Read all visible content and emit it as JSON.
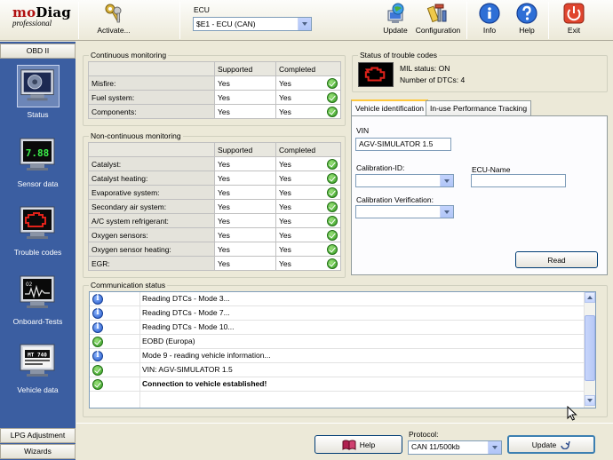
{
  "app": {
    "logo_main_a": "mo",
    "logo_main_b": "Diag",
    "logo_sub": "professional"
  },
  "toolbar": {
    "activate_label": "Activate...",
    "ecu_label": "ECU",
    "ecu_value": "$E1 - ECU (CAN)",
    "update_label": "Update",
    "configuration_label": "Configuration",
    "info_label": "Info",
    "help_label": "Help",
    "exit_label": "Exit"
  },
  "sidebar": {
    "header": "OBD II",
    "items": [
      {
        "label": "Status",
        "icon": "engine-monitor-icon",
        "active": true
      },
      {
        "label": "Sensor data",
        "icon": "sensor-display-icon",
        "screen_text": "7.88"
      },
      {
        "label": "Trouble codes",
        "icon": "engine-warning-monitor-icon"
      },
      {
        "label": "Onboard-Tests",
        "icon": "oscilloscope-monitor-icon",
        "screen_text": "O2"
      },
      {
        "label": "Vehicle data",
        "icon": "vehicle-data-monitor-icon",
        "screen_text": "MT 740"
      }
    ],
    "footer_items": [
      "LPG Adjustment",
      "Wizards"
    ]
  },
  "continuous": {
    "title": "Continuous monitoring",
    "col_supported": "Supported",
    "col_completed": "Completed",
    "rows": [
      {
        "name": "Misfire:",
        "supported": "Yes",
        "completed": "Yes"
      },
      {
        "name": "Fuel system:",
        "supported": "Yes",
        "completed": "Yes"
      },
      {
        "name": "Components:",
        "supported": "Yes",
        "completed": "Yes"
      }
    ]
  },
  "noncontinuous": {
    "title": "Non-continuous monitoring",
    "col_supported": "Supported",
    "col_completed": "Completed",
    "rows": [
      {
        "name": "Catalyst:",
        "supported": "Yes",
        "completed": "Yes"
      },
      {
        "name": "Catalyst heating:",
        "supported": "Yes",
        "completed": "Yes"
      },
      {
        "name": "Evaporative system:",
        "supported": "Yes",
        "completed": "Yes"
      },
      {
        "name": "Secondary air system:",
        "supported": "Yes",
        "completed": "Yes"
      },
      {
        "name": "A/C system refrigerant:",
        "supported": "Yes",
        "completed": "Yes"
      },
      {
        "name": "Oxygen sensors:",
        "supported": "Yes",
        "completed": "Yes"
      },
      {
        "name": "Oxygen sensor heating:",
        "supported": "Yes",
        "completed": "Yes"
      },
      {
        "name": "EGR:",
        "supported": "Yes",
        "completed": "Yes"
      }
    ]
  },
  "trouble": {
    "title": "Status of trouble codes",
    "mil_status": "MIL status: ON",
    "dtc_count": "Number of DTCs: 4"
  },
  "tabs": [
    {
      "label": "Vehicle identification",
      "active": true
    },
    {
      "label": "In-use Performance Tracking",
      "active": false
    }
  ],
  "vehicle": {
    "vin_label": "VIN",
    "vin_value": "AGV-SIMULATOR 1.5",
    "calibration_id_label": "Calibration-ID:",
    "calibration_id_value": "",
    "ecu_name_label": "ECU-Name",
    "ecu_name_value": "",
    "calibration_verification_label": "Calibration Verification:",
    "calibration_verification_value": "",
    "read_button": "Read"
  },
  "communication": {
    "title": "Communication status",
    "rows": [
      {
        "type": "info",
        "text": "Reading DTCs - Mode 3...",
        "bold": false
      },
      {
        "type": "info",
        "text": "Reading DTCs - Mode 7...",
        "bold": false
      },
      {
        "type": "info",
        "text": "Reading DTCs - Mode 10...",
        "bold": false
      },
      {
        "type": "ok",
        "text": "EOBD (Europa)",
        "bold": false
      },
      {
        "type": "info",
        "text": "Mode 9 - reading vehicle information...",
        "bold": false
      },
      {
        "type": "ok",
        "text": "VIN: AGV-SIMULATOR 1.5",
        "bold": false
      },
      {
        "type": "ok",
        "text": "Connection to vehicle established!",
        "bold": true
      }
    ]
  },
  "footer": {
    "help_button": "Help",
    "protocol_label": "Protocol:",
    "protocol_value": "CAN 11/500kb",
    "update_button": "Update"
  },
  "colors": {
    "sidebar_bg": "#3b5ea1",
    "accent_red": "#b01010",
    "ok_green": "#2f9a1e",
    "info_blue": "#1f55c8"
  }
}
